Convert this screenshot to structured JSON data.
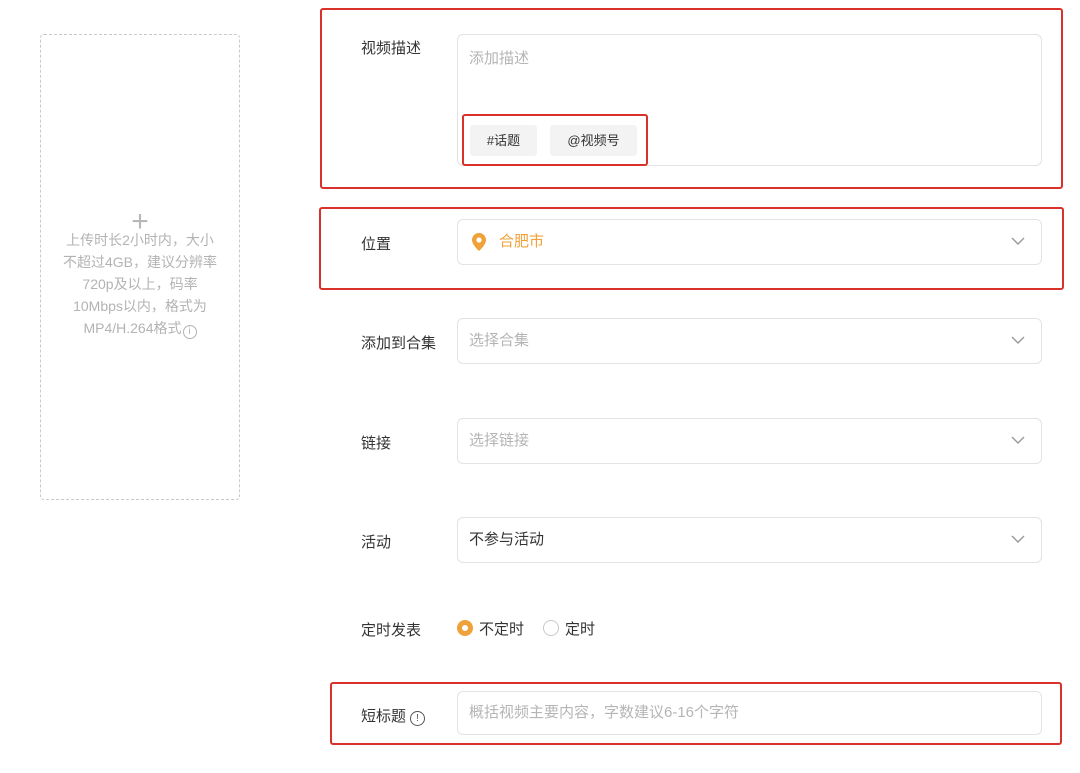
{
  "upload": {
    "plus": "+",
    "hint": "上传时长2小时内，大小不超过4GB，建议分辨率720p及以上，码率10Mbps以内，格式为MP4/H.264格式",
    "info_glyph": "i"
  },
  "description": {
    "label": "视频描述",
    "placeholder": "添加描述",
    "chip_topic": "#话题",
    "chip_mention": "@视频号"
  },
  "location": {
    "label": "位置",
    "value": "合肥市"
  },
  "collection": {
    "label": "添加到合集",
    "placeholder": "选择合集"
  },
  "link": {
    "label": "链接",
    "placeholder": "选择链接"
  },
  "activity": {
    "label": "活动",
    "value": "不参与活动"
  },
  "schedule": {
    "label": "定时发表",
    "option_none": "不定时",
    "option_timed": "定时",
    "selected": "不定时"
  },
  "short_title": {
    "label": "短标题",
    "info_glyph": "!",
    "placeholder": "概括视频主要内容，字数建议6-16个字符"
  },
  "colors": {
    "accent": "#f0a13a",
    "highlight": "#d9322b",
    "border": "#e3e3e3",
    "placeholder": "#b5b5b5"
  }
}
